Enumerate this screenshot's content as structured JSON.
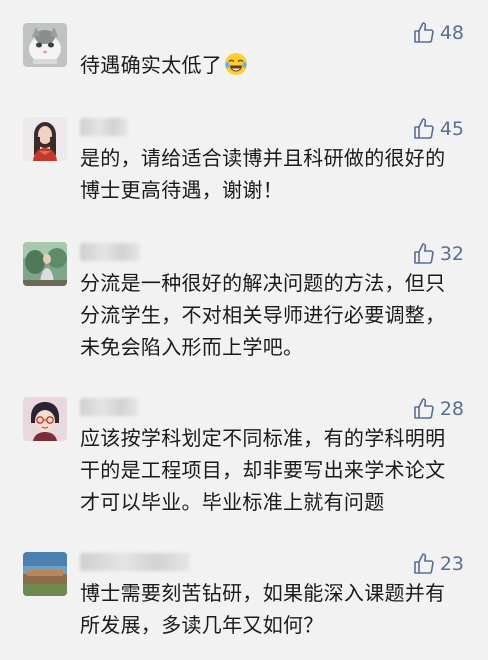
{
  "comments": [
    {
      "likes": "48",
      "text": "待遇确实太低了",
      "emoji": "face-with-tears-of-joy-emoji"
    },
    {
      "likes": "45",
      "text": "是的，请给适合读博并且科研做的很好的博士更高待遇，谢谢！"
    },
    {
      "likes": "32",
      "text": "分流是一种很好的解决问题的方法，但只分流学生，不对相关导师进行必要调整，未免会陷入形而上学吧。"
    },
    {
      "likes": "28",
      "text": "应该按学科划定不同标准，有的学科明明干的是工程项目，却非要写出来学术论文才可以毕业。毕业标准上就有问题"
    },
    {
      "likes": "23",
      "text": "博士需要刻苦钻研，如果能深入课题并有所发展，多读几年又如何？"
    }
  ],
  "icons": {
    "like": "thumbs-up-icon"
  },
  "colors": {
    "background": "#f2f2f2",
    "like": "#5a6f92",
    "text": "#1a1a1a"
  }
}
